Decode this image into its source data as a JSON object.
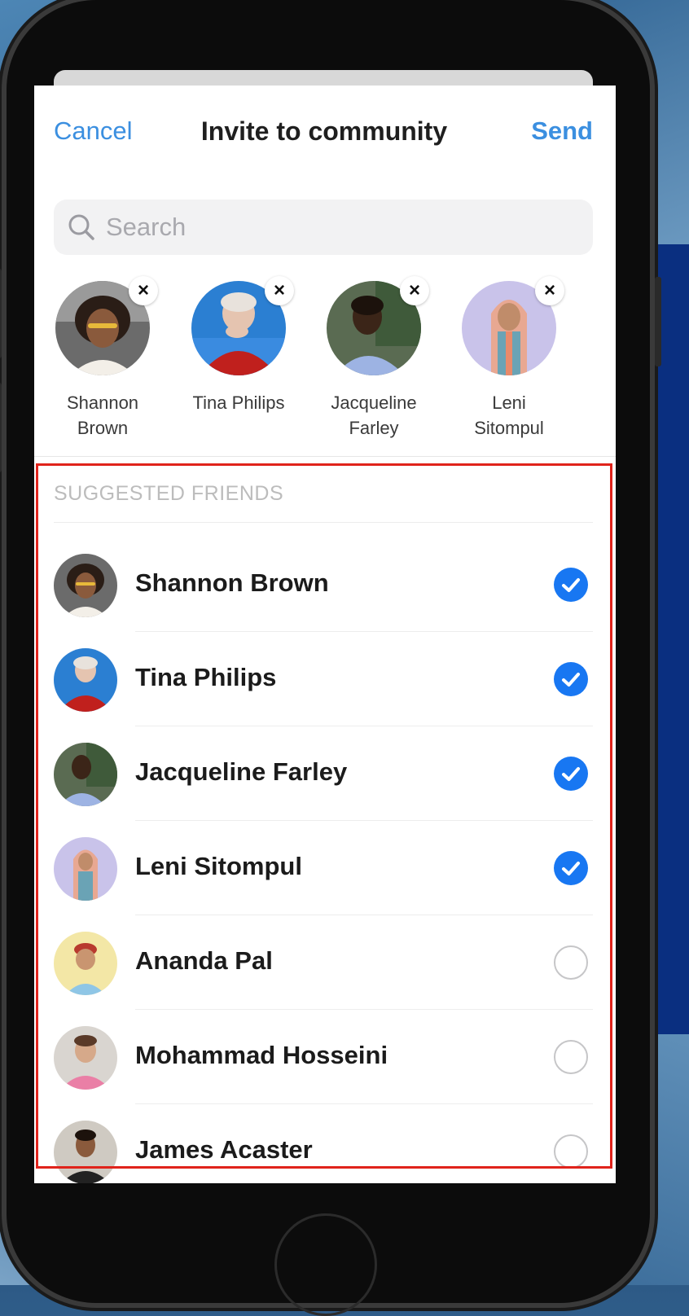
{
  "header": {
    "cancel_label": "Cancel",
    "title": "Invite to community",
    "send_label": "Send"
  },
  "search": {
    "placeholder": "Search"
  },
  "selected": [
    {
      "name_line1": "Shannon",
      "name_line2": "Brown"
    },
    {
      "name_line1": "Tina Philips",
      "name_line2": ""
    },
    {
      "name_line1": "Jacqueline",
      "name_line2": "Farley"
    },
    {
      "name_line1": "Leni",
      "name_line2": "Sitompul"
    }
  ],
  "remove_glyph": "×",
  "section_label": "SUGGESTED FRIENDS",
  "friends": [
    {
      "name": "Shannon Brown",
      "checked": true
    },
    {
      "name": "Tina Philips",
      "checked": true
    },
    {
      "name": "Jacqueline Farley",
      "checked": true
    },
    {
      "name": "Leni Sitompul",
      "checked": true
    },
    {
      "name": "Ananda Pal",
      "checked": false
    },
    {
      "name": "Mohammad Hosseini",
      "checked": false
    },
    {
      "name": "James Acaster",
      "checked": false
    }
  ],
  "colors": {
    "accent": "#3b8fe0",
    "check_on": "#1877f2",
    "highlight_border": "#e0231b"
  }
}
